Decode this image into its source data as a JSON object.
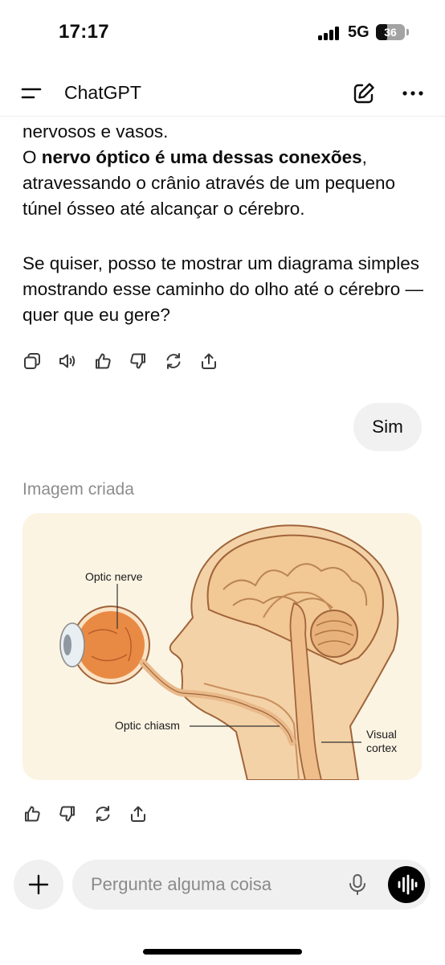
{
  "status_bar": {
    "time": "17:17",
    "network": "5G",
    "battery": "36",
    "battery_level_percent": 36
  },
  "header": {
    "title": "ChatGPT",
    "menu_icon": "menu-icon",
    "compose_icon": "new-chat-icon",
    "more_icon": "more-icon"
  },
  "assistant_message": {
    "line1": "nervosos e vasos.",
    "p1_prefix": "O ",
    "p1_bold": "nervo óptico é uma dessas conexões",
    "p1_rest": ", atravessando o crânio através de um pequeno túnel ósseo até alcançar o cérebro.",
    "p2": "Se quiser, posso te mostrar um diagrama simples mostrando esse caminho do olho até o cérebro — quer que eu gere?"
  },
  "message_actions": [
    "copy-icon",
    "read-aloud-icon",
    "thumbs-up-icon",
    "thumbs-down-icon",
    "regenerate-icon",
    "share-icon"
  ],
  "user_message": {
    "text": "Sim"
  },
  "image_message": {
    "caption": "Imagem criada",
    "labels": {
      "optic_nerve": "Optic nerve",
      "optic_chiasm": "Optic chiasm",
      "visual_cortex_line1": "Visual",
      "visual_cortex_line2": "cortex"
    },
    "colors": {
      "background": "#fbf4e3",
      "skin": "#f4d2a8",
      "brain": "#f2c895",
      "iris": "#e98a44",
      "outline": "#a0643a"
    }
  },
  "image_actions": [
    "thumbs-up-icon",
    "thumbs-down-icon",
    "regenerate-icon",
    "share-icon"
  ],
  "composer": {
    "placeholder": "Pergunte alguma coisa",
    "plus_icon": "plus-icon",
    "mic_icon": "mic-icon",
    "voice_icon": "voice-mode-icon"
  }
}
